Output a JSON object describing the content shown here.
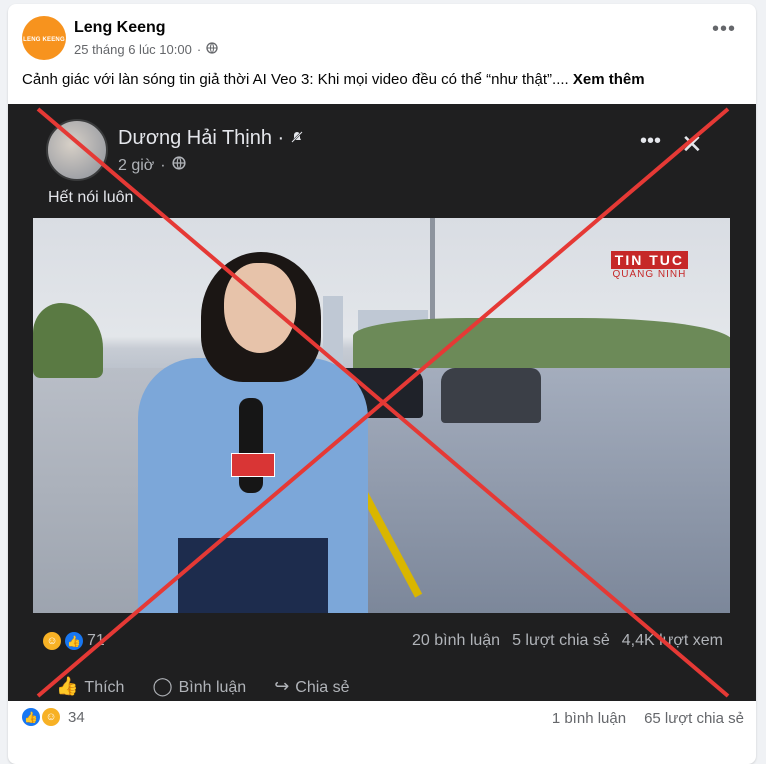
{
  "post": {
    "author": "Leng Keeng",
    "avatar_text": "LENG KEENG",
    "timestamp": "25 tháng 6 lúc 10:00",
    "separator": "·",
    "privacy_icon": "globe-icon",
    "more_icon": "•••",
    "text": "Cảnh giác với làn sóng tin giả thời AI Veo 3: Khi mọi video đều có thể “như thật”....",
    "see_more": "Xem thêm"
  },
  "embedded": {
    "author": "Dương Hải Thịnh",
    "author_suffix": "·",
    "time": "2 giờ",
    "time_sep": "·",
    "text": "Hết nói luôn",
    "more_icon": "•••",
    "close_icon": "✕",
    "video_badge_main": "TIN TUC",
    "video_badge_sub": "QUẢNG NINH",
    "reaction_count": "71",
    "comments": "20 bình luận",
    "shares": "5 lượt chia sẻ",
    "views": "4,4K lượt xem",
    "actions": {
      "like": "Thích",
      "comment": "Bình luận",
      "share": "Chia sẻ"
    }
  },
  "stats": {
    "reaction_count": "34",
    "comments": "1 bình luận",
    "shares": "65 lượt chia sẻ"
  },
  "colors": {
    "x_mark": "#e53935",
    "link": "#050505",
    "muted": "#65676b"
  }
}
